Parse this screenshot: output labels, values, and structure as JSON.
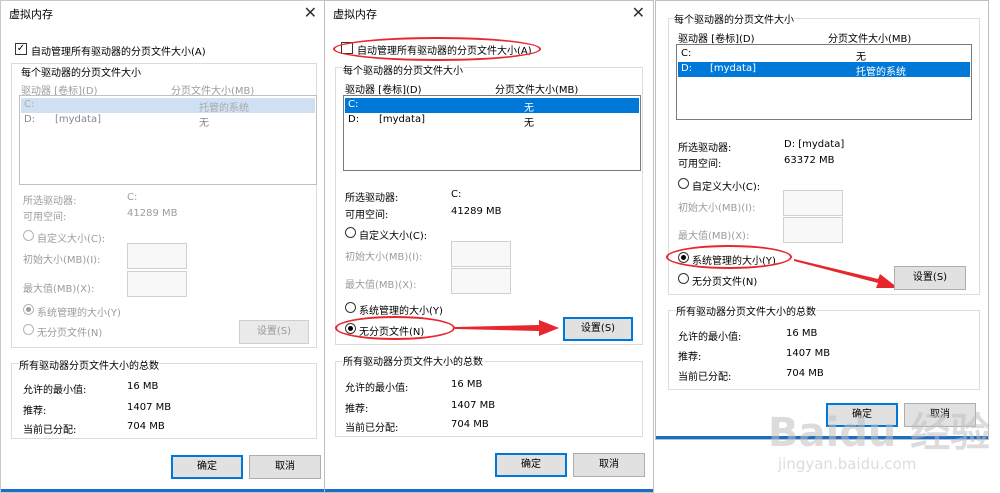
{
  "colors": {
    "accent": "#0078d7",
    "annotation": "#e8262e",
    "selected_row": "#0078d7"
  },
  "common": {
    "title": "虚拟内存",
    "auto_manage": "自动管理所有驱动器的分页文件大小(A)",
    "per_drive_group": "每个驱动器的分页文件大小",
    "col_drive": "驱动器 [卷标](D)",
    "col_size": "分页文件大小(MB)",
    "selected_drive_label": "所选驱动器:",
    "free_space_label": "可用空间:",
    "custom_size": "自定义大小(C):",
    "initial_size": "初始大小(MB)(I):",
    "max_size": "最大值(MB)(X):",
    "system_managed": "系统管理的大小(Y)",
    "no_paging": "无分页文件(N)",
    "set_button": "设置(S)",
    "total_group": "所有驱动器分页文件大小的总数",
    "min_allowed_label": "允许的最小值:",
    "recommended_label": "推荐:",
    "current_label": "当前已分配:",
    "min_allowed": "16 MB",
    "recommended": "1407 MB",
    "current": "704 MB",
    "ok": "确定",
    "cancel": "取消",
    "close": "✕"
  },
  "dialog1": {
    "auto_checked": true,
    "rows": [
      {
        "drive": "C:",
        "label": "",
        "size": "托管的系统"
      },
      {
        "drive": "D:",
        "label": "[mydata]",
        "size": "无"
      }
    ],
    "selected_drive": "C:",
    "free_space": "41289 MB",
    "mode": "system_managed"
  },
  "dialog2": {
    "auto_checked": false,
    "rows": [
      {
        "drive": "C:",
        "label": "",
        "size": "无"
      },
      {
        "drive": "D:",
        "label": "[mydata]",
        "size": "无"
      }
    ],
    "selected_drive": "C:",
    "free_space": "41289 MB",
    "mode": "no_paging"
  },
  "dialog3": {
    "rows": [
      {
        "drive": "C:",
        "label": "",
        "size": "无"
      },
      {
        "drive": "D:",
        "label": "[mydata]",
        "size": "托管的系统"
      }
    ],
    "selected_drive": "D:  [mydata]",
    "free_space": "63372 MB",
    "mode": "system_managed"
  },
  "watermark": {
    "brand": "Baidu 经验",
    "url": "jingyan.baidu.com"
  }
}
